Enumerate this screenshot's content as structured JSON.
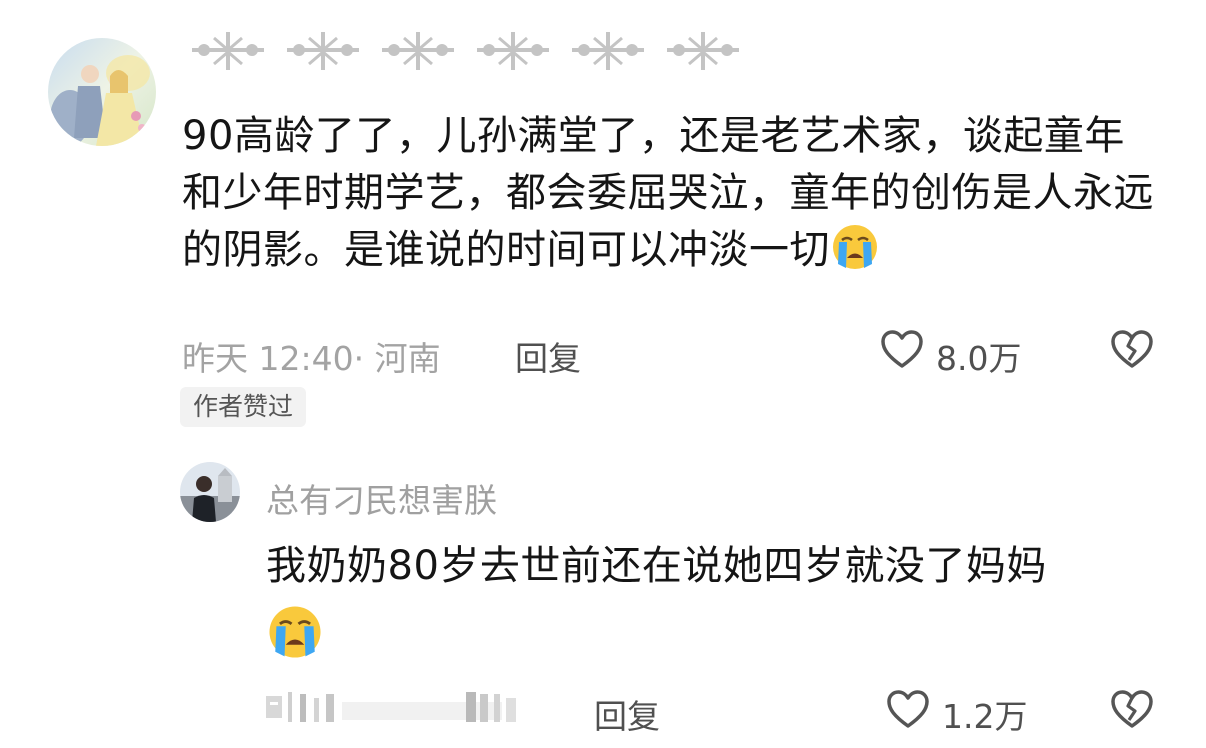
{
  "main_comment": {
    "text_before_emoji": "90高龄了了，儿孙满堂了，还是老艺术家，谈起童年和少年时期学艺，都会委屈哭泣，童年的创伤是人永远的阴影。是谁说的时间可以冲淡一切",
    "emoji": "loudly-crying-face",
    "time_location": "昨天 12:40· 河南",
    "reply_label": "回复",
    "like_count": "8.0万",
    "badge": "作者赞过"
  },
  "sub_comment": {
    "username": "总有刁民想害朕",
    "text": "我奶奶80岁去世前还在说她四岁就没了妈妈",
    "emoji": "loudly-crying-face",
    "reply_label": "回复",
    "like_count": "1.2万"
  },
  "colors": {
    "text_primary": "#151515",
    "text_secondary": "#a3a3a3",
    "text_action": "#505050",
    "emoji_yellow": "#f9c93c",
    "emoji_tear": "#3ea7f2"
  }
}
